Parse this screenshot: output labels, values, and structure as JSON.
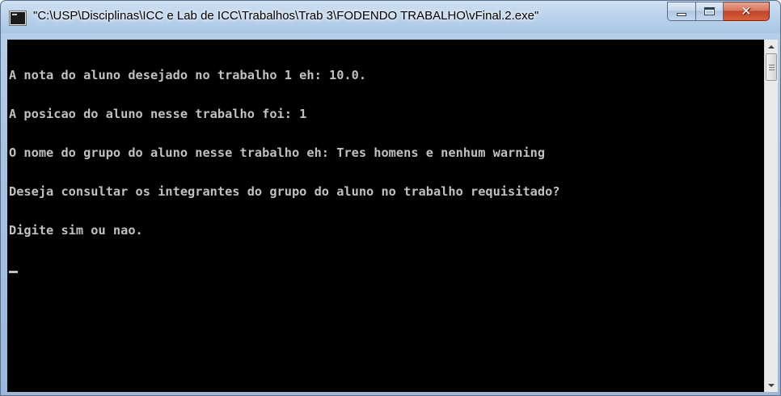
{
  "window": {
    "title": "\"C:\\USP\\Disciplinas\\ICC e Lab de ICC\\Trabalhos\\Trab 3\\FODENDO TRABALHO\\vFinal.2.exe\"",
    "icon": "console-app-icon"
  },
  "caption_buttons": {
    "minimize_icon": "minimize-icon",
    "maximize_icon": "maximize-icon",
    "close_icon": "close-icon",
    "close_glyph": "✕"
  },
  "console": {
    "lines": [
      "A nota do aluno desejado no trabalho 1 eh: 10.0.",
      "A posicao do aluno nesse trabalho foi: 1",
      "O nome do grupo do aluno nesse trabalho eh: Tres homens e nenhum warning",
      "Deseja consultar os integrantes do grupo do aluno no trabalho requisitado?",
      "Digite sim ou nao."
    ],
    "cursor": "blinking-underscore-cursor"
  },
  "scrollbar": {
    "up_icon": "scroll-up-arrow-icon",
    "down_icon": "scroll-down-arrow-icon"
  },
  "colors": {
    "console_background": "#000000",
    "console_text": "#c0c0c0",
    "close_button": "#c2432a"
  }
}
